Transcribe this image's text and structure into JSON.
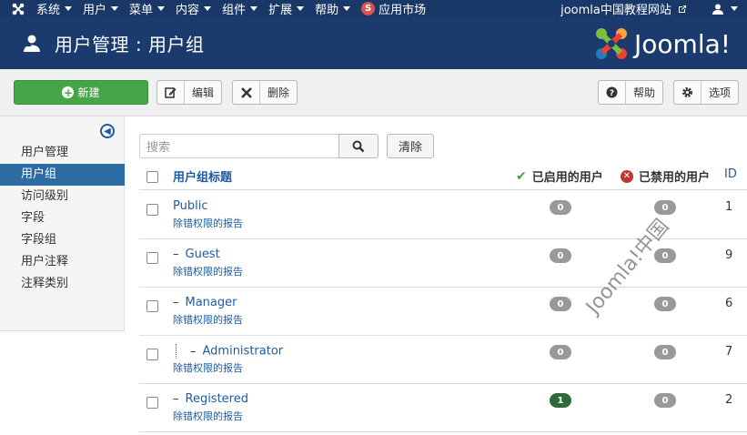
{
  "topbar": {
    "menu": [
      "系统",
      "用户",
      "菜单",
      "内容",
      "组件",
      "扩展",
      "帮助"
    ],
    "market_badge": "S",
    "market": "应用市场",
    "site_link": "joomla中国教程网站"
  },
  "header": {
    "title": "用户管理 : 用户组",
    "brand": "Joomla!"
  },
  "toolbar": {
    "new": "新建",
    "edit": "编辑",
    "delete": "删除",
    "help": "帮助",
    "options": "选项"
  },
  "sidebar": {
    "items": [
      "用户管理",
      "用户组",
      "访问级别",
      "字段",
      "字段组",
      "用户注释",
      "注释类别"
    ],
    "active": "用户组"
  },
  "search": {
    "placeholder": "搜索",
    "clear": "清除"
  },
  "table": {
    "headers": {
      "title": "用户组标题",
      "enabled": "已启用的用户",
      "disabled": "已禁用的用户",
      "id": "ID"
    },
    "rows": [
      {
        "name": "Public",
        "prefix": "",
        "sub": "除错权限的报告",
        "enabled": "0",
        "disabled": "0",
        "id": "1"
      },
      {
        "name": "Guest",
        "prefix": "–",
        "sub": "除错权限的报告",
        "enabled": "0",
        "disabled": "0",
        "id": "9"
      },
      {
        "name": "Manager",
        "prefix": "–",
        "sub": "除错权限的报告",
        "enabled": "0",
        "disabled": "0",
        "id": "6"
      },
      {
        "name": "Administrator",
        "prefix": "–",
        "sub": "除错权限的报告",
        "enabled": "0",
        "disabled": "0",
        "id": "7"
      },
      {
        "name": "Registered",
        "prefix": "–",
        "sub": "除错权限的报告",
        "enabled": "1",
        "disabled": "0",
        "id": "2"
      }
    ]
  },
  "watermark": "Joomla!中国",
  "colors": {
    "navbar": "#1a3867",
    "header": "#1b3a6d",
    "new_button": "#46a546",
    "sidebar_active": "#2d6ca2",
    "link": "#1f5aa3",
    "badge_default": "#999999",
    "badge_enabled": "#2f6b3a"
  }
}
